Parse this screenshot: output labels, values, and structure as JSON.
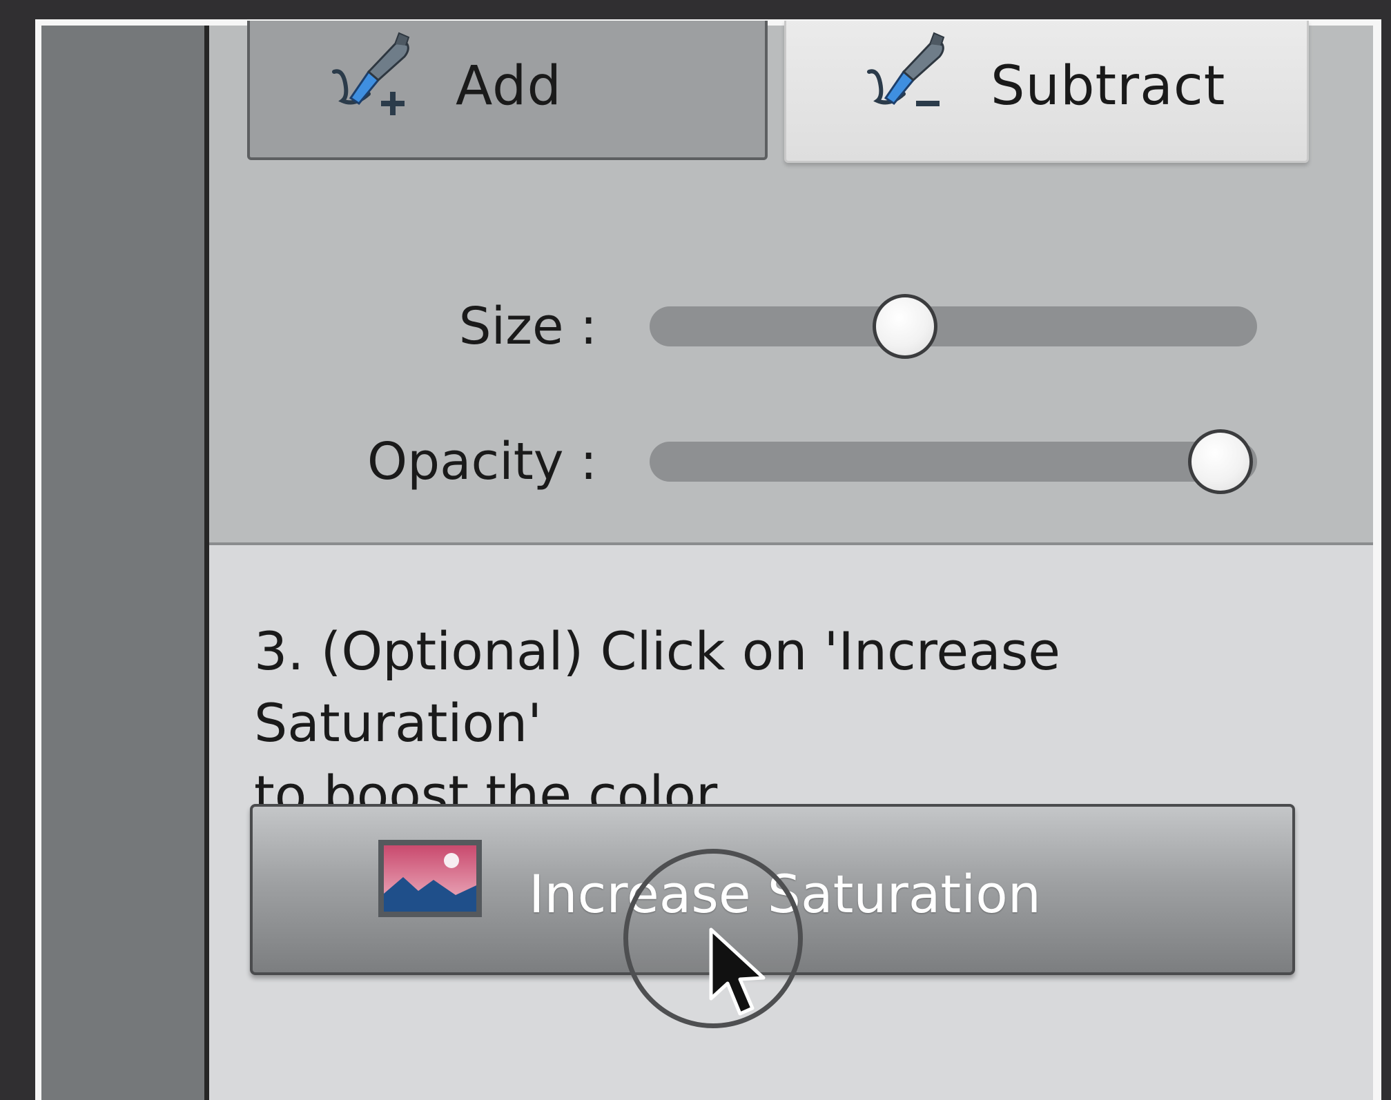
{
  "mode_buttons": {
    "add_label": "Add",
    "subtract_label": "Subtract",
    "add_icon": "brush-add-icon",
    "subtract_icon": "brush-subtract-icon",
    "selected": "subtract"
  },
  "sliders": {
    "size": {
      "label": "Size :",
      "value_fraction": 0.42
    },
    "opacity": {
      "label": "Opacity :",
      "value_fraction": 0.94
    }
  },
  "step3": {
    "line1": "3. (Optional) Click on 'Increase Saturation'",
    "line2": "to boost the color.",
    "button_label": "Increase Saturation",
    "button_icon": "landscape-photo-icon"
  },
  "colors": {
    "brush_blue": "#3f8fe0",
    "photo_pink": "#d9748f",
    "photo_mountain": "#1f4f8a"
  }
}
